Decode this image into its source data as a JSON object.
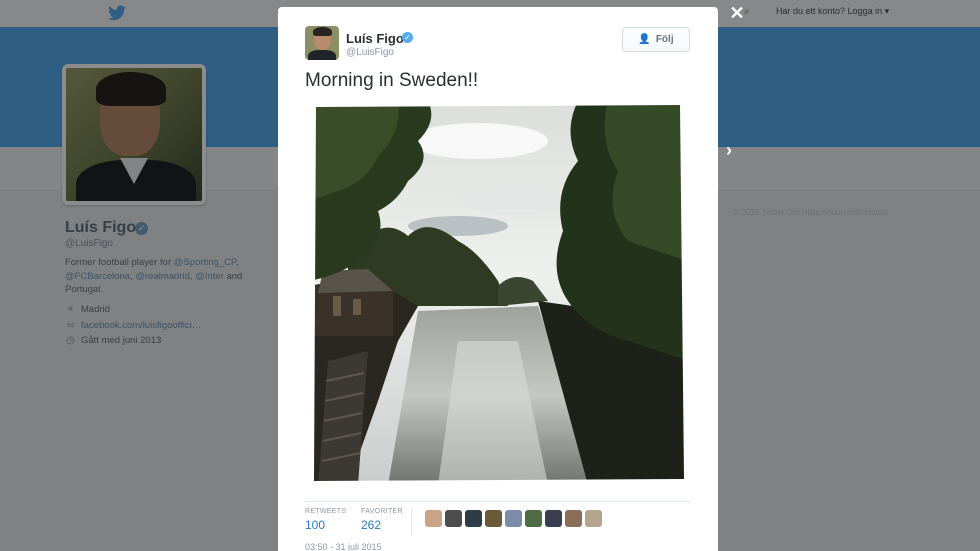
{
  "topbar": {
    "login_prompt": "Har du ett konto? Logga in ▾",
    "search_icon": "search-icon",
    "logo_icon": "twitter-bird-icon"
  },
  "profile": {
    "name": "Luís Figo",
    "handle": "@LuisFigo",
    "bio_prefix": "Former football player for ",
    "bio_link_1": "@Sporting_CP",
    "bio_sep_1": ",",
    "bio_link_2": "@FCBarcelona",
    "bio_sep_2": ", ",
    "bio_link_3": "@realmadrid",
    "bio_sep_3": ", ",
    "bio_link_4": "@Inter",
    "bio_suffix": " and Portugal.",
    "location": "Madrid",
    "website": "facebook.com/luisfigooffici…",
    "joined": "Gått med juni 2013"
  },
  "footer_faint": "© 2015 Twitter   Om   Hjälp   Annonsinformation",
  "modal": {
    "close_label": "✕",
    "next_label": "›",
    "tweet": {
      "author_name": "Luís Figo",
      "author_handle": "@LuisFigo",
      "follow_label": "Följ",
      "text": "Morning in Sweden!!",
      "retweets_label": "RETWEETS",
      "retweets_count": "100",
      "favorites_label": "FAVORITER",
      "favorites_count": "262",
      "timestamp": "03:50 - 31 juli 2015"
    }
  },
  "colors": {
    "twitter_blue": "#55acee",
    "link_blue": "#2b7bb9",
    "banner": "#55acee"
  }
}
